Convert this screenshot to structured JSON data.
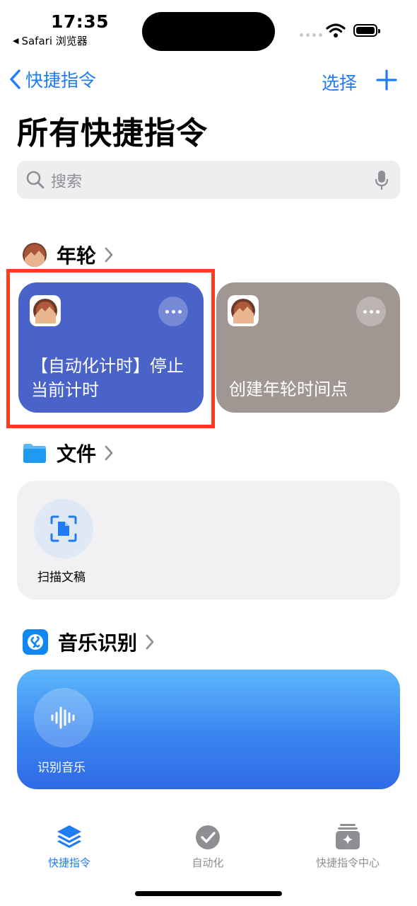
{
  "status_bar": {
    "time": "17:35",
    "back_app": "Safari 浏览器"
  },
  "nav": {
    "back_label": "快捷指令",
    "select_label": "选择"
  },
  "page_title": "所有快捷指令",
  "search": {
    "placeholder": "搜索"
  },
  "sections": {
    "nianlun": {
      "label": "年轮",
      "cards": [
        {
          "title_line1": "【自动化计时】停止",
          "title_line2": "当前计时",
          "color": "#4a63c9"
        },
        {
          "title_line1": "创建年轮时间点",
          "title_line2": "",
          "color": "#a19792"
        }
      ]
    },
    "files": {
      "label": "文件",
      "action_label": "扫描文稿"
    },
    "music": {
      "label": "音乐识别",
      "action_label": "识别音乐"
    }
  },
  "tabs": [
    {
      "label": "快捷指令",
      "active": true
    },
    {
      "label": "自动化",
      "active": false
    },
    {
      "label": "快捷指令中心",
      "active": false
    }
  ],
  "colors": {
    "accent": "#1f7bf6",
    "highlight": "#ff3b1f",
    "inactive_tab": "#8e8e93"
  }
}
